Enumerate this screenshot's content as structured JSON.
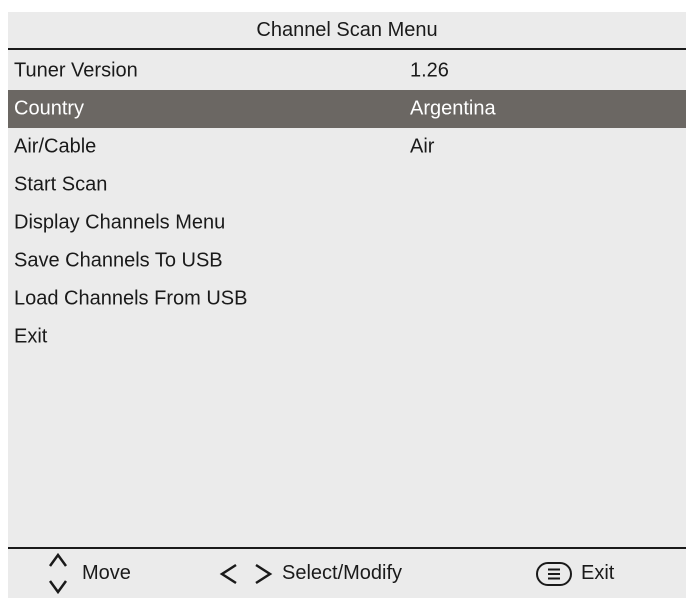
{
  "menu": {
    "title": "Channel Scan Menu",
    "items": [
      {
        "label": "Tuner Version",
        "value": "1.26"
      },
      {
        "label": "Country",
        "value": "Argentina"
      },
      {
        "label": "Air/Cable",
        "value": "Air"
      },
      {
        "label": "Start Scan",
        "value": ""
      },
      {
        "label": "Display Channels Menu",
        "value": ""
      },
      {
        "label": "Save Channels To USB",
        "value": ""
      },
      {
        "label": "Load Channels From USB",
        "value": ""
      },
      {
        "label": "Exit",
        "value": ""
      }
    ],
    "selected_item": "Country"
  },
  "footer": {
    "move_label": "Move",
    "move_icon": "up-down-arrows-icon",
    "select_label": "Select/Modify",
    "select_icon": "left-right-arrows-icon",
    "exit_label": "Exit",
    "exit_icon": "menu-button-icon"
  },
  "colors": {
    "panel_background": "#ebebeb",
    "selected_row": "#6b6763",
    "text": "#1a1a1a",
    "selected_text": "#ffffff"
  }
}
